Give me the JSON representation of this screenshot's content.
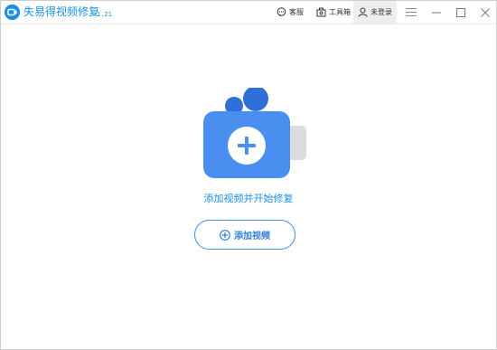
{
  "titlebar": {
    "app_title": "失易得视频修复",
    "version": "1.21",
    "service_label": "客服",
    "tools_label": "工具箱",
    "login_label": "未登录"
  },
  "main": {
    "hint": "添加视频并开始修复",
    "add_button_label": "添加视频"
  },
  "colors": {
    "accent": "#1a8fe3",
    "camera_body": "#4a8ef0",
    "camera_bubble": "#2f6fd8",
    "camera_side": "#dcdcdc"
  },
  "icons": {
    "logo": "app-logo-icon",
    "service": "chat-bubble-icon",
    "tools": "toolbox-icon",
    "login": "user-icon",
    "menu": "hamburger-icon",
    "minimize": "minimize-icon",
    "maximize": "maximize-icon",
    "close": "close-icon",
    "add": "plus-circle-icon"
  }
}
